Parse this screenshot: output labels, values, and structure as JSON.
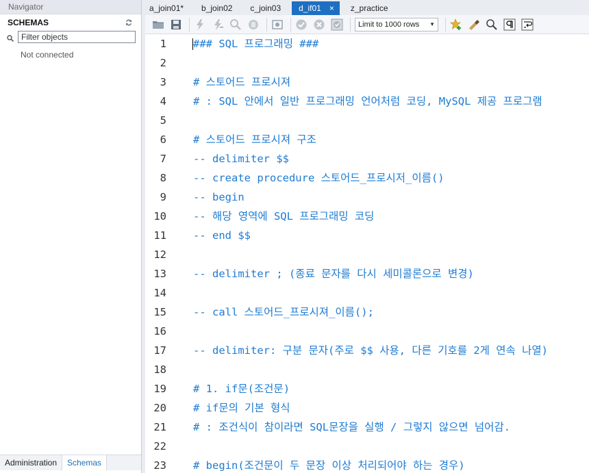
{
  "navigator": {
    "title": "Navigator",
    "schemas_label": "SCHEMAS",
    "filter_placeholder": "Filter objects",
    "status": "Not connected",
    "bottom_tabs": [
      "Administration",
      "Schemas"
    ]
  },
  "tabs": [
    {
      "label": "a_join01*",
      "active": false
    },
    {
      "label": "b_join02",
      "active": false
    },
    {
      "label": "c_join03",
      "active": false
    },
    {
      "label": "d_if01",
      "active": true
    },
    {
      "label": "z_practice",
      "active": false
    }
  ],
  "tab_close_glyph": "×",
  "toolbar": {
    "limit_select": "Limit to 1000 rows"
  },
  "colors": {
    "code": "#1d7bd2",
    "active_tab": "#1e6fc2"
  },
  "editor_lines": [
    {
      "num": "1",
      "text": "### SQL 프로그래밍 ###"
    },
    {
      "num": "2",
      "text": ""
    },
    {
      "num": "3",
      "text": "# 스토어드 프로시져"
    },
    {
      "num": "4",
      "text": "# : SQL 안에서 일반 프로그래밍 언어처럼 코딩, MySQL 제공 프로그램"
    },
    {
      "num": "5",
      "text": ""
    },
    {
      "num": "6",
      "text": "# 스토어드 프로시져 구조"
    },
    {
      "num": "7",
      "text": "-- delimiter $$"
    },
    {
      "num": "8",
      "text": "-- create procedure 스토어드_프로시저_이름()"
    },
    {
      "num": "9",
      "text": "-- begin"
    },
    {
      "num": "10",
      "text": "-- 해당 영역에 SQL 프로그래밍 코딩"
    },
    {
      "num": "11",
      "text": "-- end $$"
    },
    {
      "num": "12",
      "text": ""
    },
    {
      "num": "13",
      "text": "-- delimiter ; (종료 문자를 다시 세미콜론으로 변경)"
    },
    {
      "num": "14",
      "text": ""
    },
    {
      "num": "15",
      "text": "-- call 스토어드_프로시져_이름();"
    },
    {
      "num": "16",
      "text": ""
    },
    {
      "num": "17",
      "text": "-- delimiter: 구분 문자(주로 $$ 사용, 다른 기호를 2게 연속 나열)"
    },
    {
      "num": "18",
      "text": ""
    },
    {
      "num": "19",
      "text": "# 1. if문(조건문)"
    },
    {
      "num": "20",
      "text": "# if문의 기본 형식"
    },
    {
      "num": "21",
      "text": "# : 조건식이 참이라면 SQL문장을 실행 / 그렇지 않으면 넘어감."
    },
    {
      "num": "22",
      "text": ""
    },
    {
      "num": "23",
      "text": "# begin(조건문이 두 문장 이상 처리되어야 하는 경우)"
    }
  ]
}
